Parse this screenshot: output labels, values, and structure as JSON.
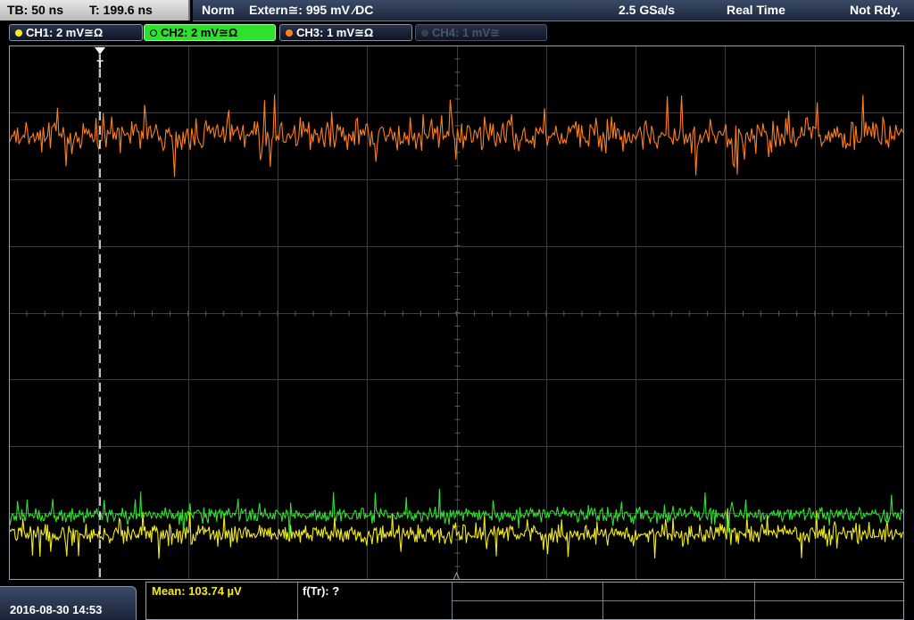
{
  "status_bar": {
    "timebase": "TB: 50 ns",
    "trigger_time": "T: 199.6 ns",
    "acq_mode": "Norm",
    "trigger_setting": "Extern≅: 995 mV ∕DC",
    "sample_rate": "2.5 GSa/s",
    "acq_type": "Real Time",
    "run_status": "Not Rdy."
  },
  "channels": [
    {
      "label": "CH1: 2 mV≅Ω",
      "color": "#f2ea1a",
      "state": "on"
    },
    {
      "label": "CH2: 2 mV≅Ω",
      "color": "#2fe02f",
      "state": "selected"
    },
    {
      "label": "CH3: 1 mV≅Ω",
      "color": "#ff7f1a",
      "state": "on"
    },
    {
      "label": "CH4: 1 mV≅",
      "color": "#4e5566",
      "state": "off"
    }
  ],
  "trigger_marker_label": "T",
  "waveforms": {
    "orange_color": "#ff7f1a",
    "green_color": "#2fe02f",
    "yellow_color": "#f2ea1a"
  },
  "measurements": {
    "mean": "Mean: 103.74 µV",
    "freq": "f(Tr): ?"
  },
  "datetime": "2016-08-30 14:53"
}
